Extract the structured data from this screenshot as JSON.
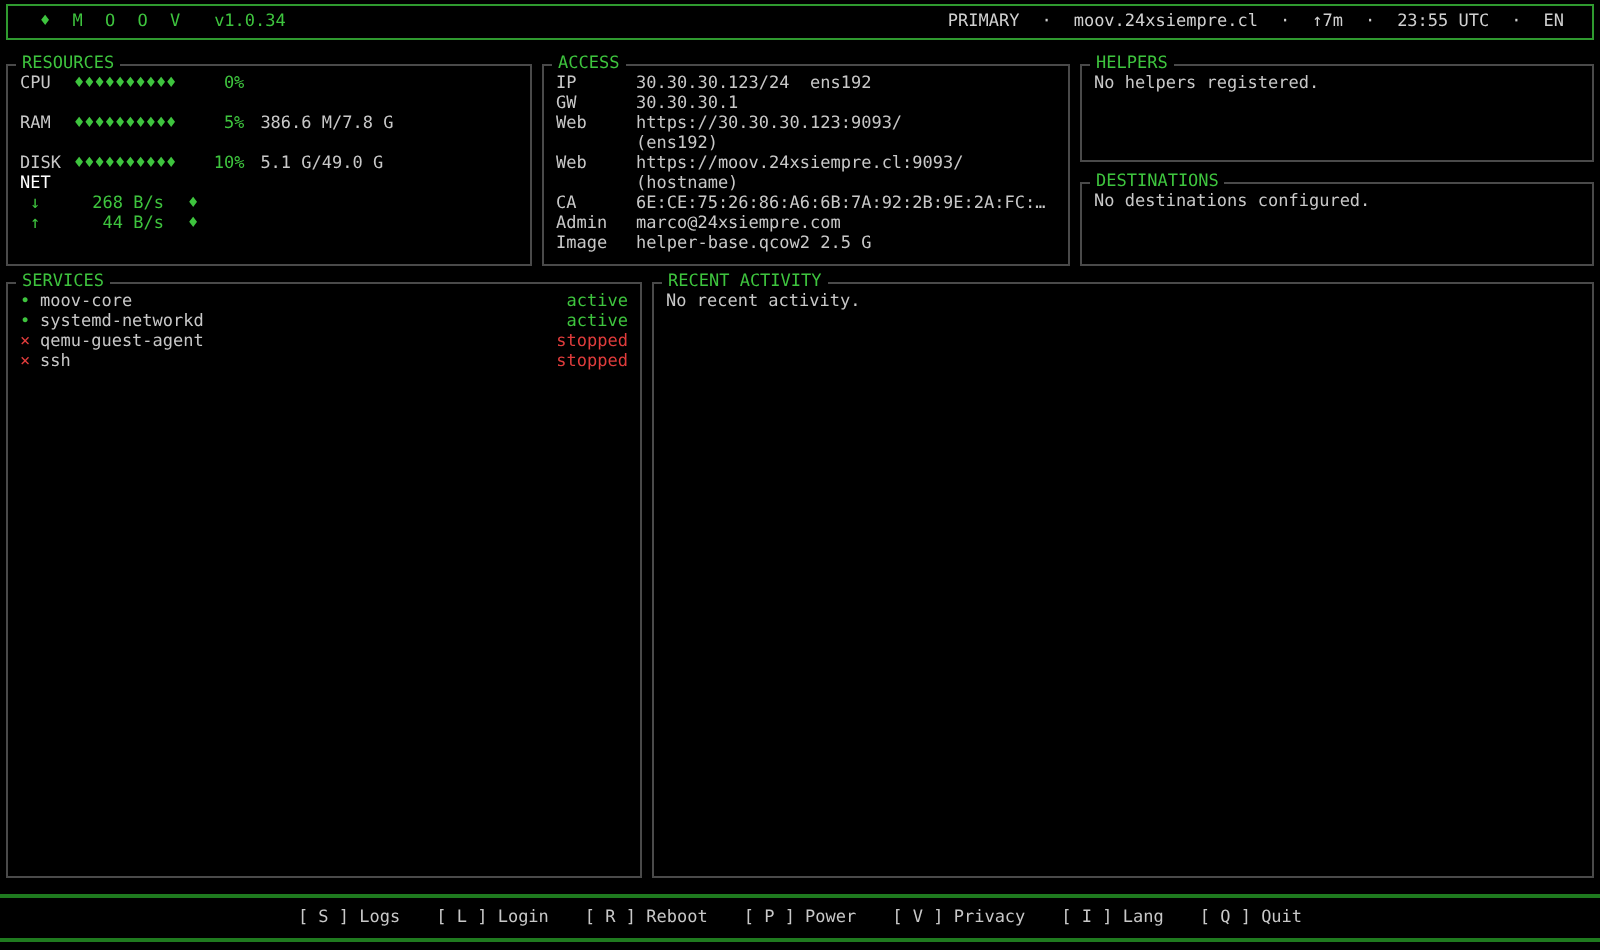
{
  "header": {
    "logo": "♦ M O O V",
    "version": "v1.0.34",
    "status": [
      "PRIMARY",
      "moov.24xsiempre.cl",
      "↑7m",
      "23:55 UTC",
      "EN"
    ],
    "separator": "·"
  },
  "resources": {
    "title": "RESOURCES",
    "metrics": [
      {
        "label": "CPU",
        "bar": "♦♦♦♦♦♦♦♦♦♦",
        "percent": "0%"
      },
      {
        "label": "RAM",
        "bar": "♦♦♦♦♦♦♦♦♦♦",
        "percent": "5%",
        "detail": "386.6 M/7.8 G"
      },
      {
        "label": "DISK",
        "bar": "♦♦♦♦♦♦♦♦♦♦",
        "percent": "10%",
        "detail": "5.1 G/49.0 G"
      }
    ],
    "net": {
      "label": "NET",
      "rows": [
        {
          "arrow": "↓",
          "rate": "268 B/s",
          "spark": "♦"
        },
        {
          "arrow": "↑",
          "rate": "44 B/s",
          "spark": "♦"
        }
      ]
    }
  },
  "access": {
    "title": "ACCESS",
    "rows": [
      {
        "key": "IP",
        "value": "30.30.30.123/24  ens192"
      },
      {
        "key": "GW",
        "value": "30.30.30.1"
      },
      {
        "key": "Web",
        "value": "https://30.30.30.123:9093/",
        "note": "(ens192)"
      },
      {
        "key": "Web",
        "value": "https://moov.24xsiempre.cl:9093/",
        "note": "(hostname)"
      },
      {
        "key": "CA",
        "value": "6E:CE:75:26:86:A6:6B:7A:92:2B:9E:2A:FC:…"
      },
      {
        "key": "Admin",
        "value": "marco@24xsiempre.com"
      },
      {
        "key": "Image",
        "value": "helper-base.qcow2 2.5 G"
      }
    ]
  },
  "helpers": {
    "title": "HELPERS",
    "message": "No helpers registered."
  },
  "destinations": {
    "title": "DESTINATIONS",
    "message": "No destinations configured."
  },
  "services": {
    "title": "SERVICES",
    "items": [
      {
        "icon": "•",
        "name": "moov-core",
        "status": "active",
        "running": true
      },
      {
        "icon": "•",
        "name": "systemd-networkd",
        "status": "active",
        "running": true
      },
      {
        "icon": "×",
        "name": "qemu-guest-agent",
        "status": "stopped",
        "running": false
      },
      {
        "icon": "×",
        "name": "ssh",
        "status": "stopped",
        "running": false
      }
    ]
  },
  "recent_activity": {
    "title": "RECENT ACTIVITY",
    "message": "No recent activity."
  },
  "footer": {
    "keys": [
      {
        "key": "[ S ]",
        "label": "Logs"
      },
      {
        "key": "[ L ]",
        "label": "Login"
      },
      {
        "key": "[ R ]",
        "label": "Reboot"
      },
      {
        "key": "[ P ]",
        "label": "Power"
      },
      {
        "key": "[ V ]",
        "label": "Privacy"
      },
      {
        "key": "[ I ]",
        "label": "Lang"
      },
      {
        "key": "[ Q ]",
        "label": "Quit"
      }
    ]
  }
}
